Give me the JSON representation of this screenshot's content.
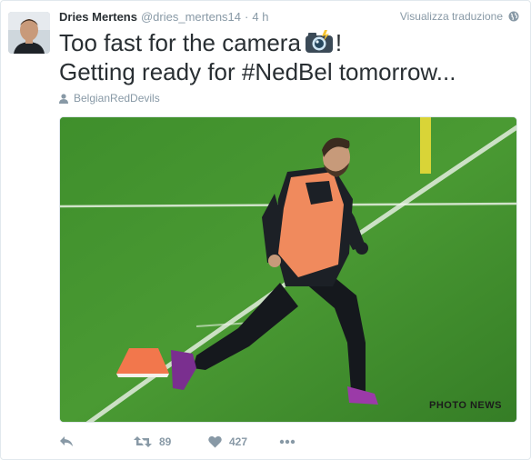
{
  "tweet": {
    "author": {
      "full_name": "Dries Mertens",
      "handle": "@dries_mertens14",
      "avatar_icon": "profile-photo"
    },
    "separator": "·",
    "time": "4 h",
    "translate_label": "Visualizza traduzione",
    "text_line1_before": "Too fast for the camera",
    "text_line1_emoji": "camera-with-flash-icon",
    "text_line1_after": "!",
    "text_line2": "Getting ready for #NedBel tomorrow...",
    "context_label": "BelgianRedDevils",
    "media": {
      "description_icon": "football-training-photo",
      "watermark": "PHOTO NEWS"
    },
    "actions": {
      "reply_icon": "reply-icon",
      "retweet_icon": "retweet-icon",
      "retweet_count": "89",
      "like_icon": "heart-icon",
      "like_count": "427",
      "more_icon": "more-icon"
    },
    "colors": {
      "text": "#292f33",
      "muted": "#8899a6",
      "pitch_green": "#3d8a2b",
      "bib_orange": "#f08a5d"
    }
  }
}
